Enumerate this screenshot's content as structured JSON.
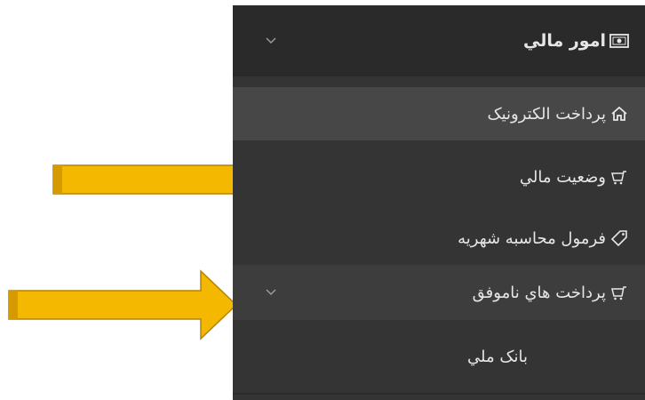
{
  "menu": {
    "header": {
      "label": "امور مالي",
      "icon": "money-icon",
      "chevron": "chevron-down-icon"
    },
    "items": [
      {
        "label": "پرداخت الكترونيک",
        "icon": "home-icon"
      },
      {
        "label": "وضعيت مالي",
        "icon": "cart-icon"
      },
      {
        "label": "فرمول محاسبه شهريه",
        "icon": "tag-icon"
      },
      {
        "label": "پرداخت هاي ناموفق",
        "icon": "cart-icon",
        "chevron": "chevron-down-icon"
      },
      {
        "label": "بانک ملي"
      }
    ]
  },
  "colors": {
    "menu_bg": "#343434",
    "header_bg": "#2a2a2a",
    "active_bg": "#474747",
    "text": "#e6e6e6",
    "arrow": "#f5b800"
  }
}
